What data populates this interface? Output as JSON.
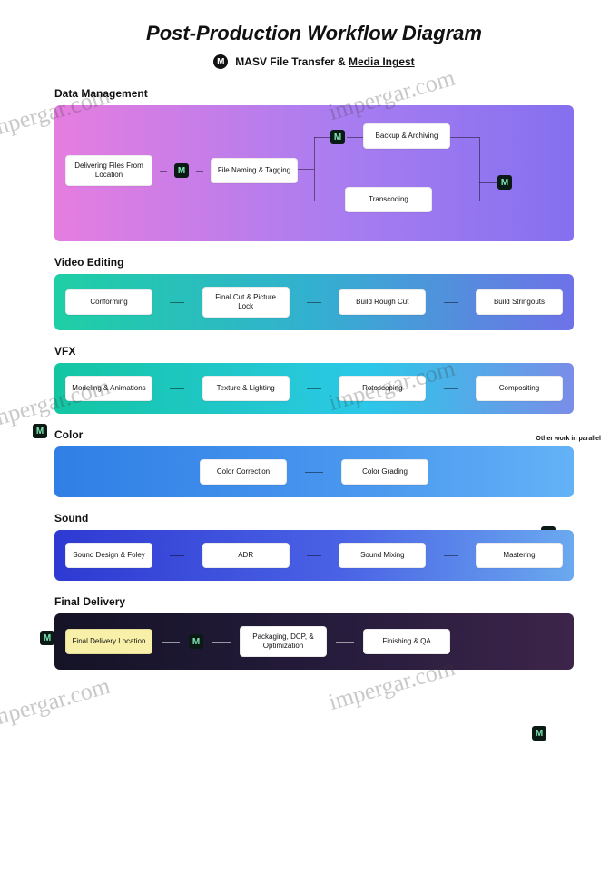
{
  "title": "Post-Production Workflow Diagram",
  "subtitle_prefix": "MASV File Transfer & ",
  "subtitle_underlined": "Media Ingest",
  "watermark": "impergar.com",
  "masv_glyph": "M",
  "side_note": "Other work in parallel",
  "sections": {
    "data": {
      "label": "Data Management",
      "nodes": {
        "deliver": "Delivering Files From Location",
        "naming": "File Naming & Tagging",
        "backup": "Backup & Archiving",
        "transcode": "Transcoding"
      }
    },
    "video": {
      "label": "Video Editing",
      "nodes": {
        "conform": "Conforming",
        "lock": "Final Cut & Picture Lock",
        "rough": "Build Rough Cut",
        "string": "Build Stringouts"
      }
    },
    "vfx": {
      "label": "VFX",
      "nodes": {
        "model": "Modeling & Animations",
        "texture": "Texture & Lighting",
        "roto": "Rotoscoping",
        "comp": "Compositing"
      }
    },
    "color": {
      "label": "Color",
      "nodes": {
        "corr": "Color Correction",
        "grade": "Color Grading"
      }
    },
    "sound": {
      "label": "Sound",
      "nodes": {
        "design": "Sound Design & Foley",
        "adr": "ADR",
        "mix": "Sound Mixing",
        "master": "Mastering"
      }
    },
    "final": {
      "label": "Final Delivery",
      "nodes": {
        "loc": "Final Delivery Location",
        "pack": "Packaging, DCP, & Optimization",
        "finish": "Finishing & QA"
      }
    }
  }
}
